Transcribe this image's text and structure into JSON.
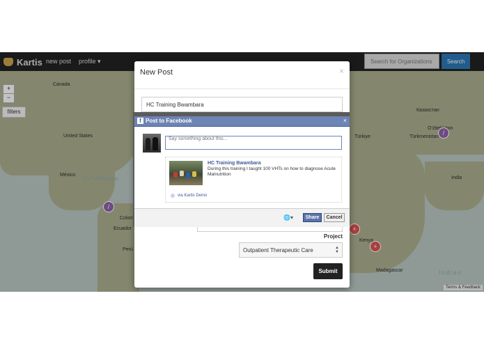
{
  "navbar": {
    "brand": "Kartis",
    "new_post": "new post",
    "profile": "profile",
    "profile_caret": "▾",
    "search_placeholder": "Search for Organizations",
    "search_button": "Search"
  },
  "map": {
    "zoom_in": "+",
    "zoom_out": "−",
    "filters": "filters",
    "labels": {
      "canada": "Canada",
      "united_states": "United States",
      "mexico": "México",
      "colombia": "Colombia",
      "ecuador": "Ecuador",
      "peru": "Perú",
      "kazakhstan": "Казахстан",
      "uzbekistan": "O'zbekiston",
      "turkmenistan": "Türkmenistan",
      "turkiye": "Türkiye",
      "kenya": "Kenya",
      "madagascar": "Madagascar",
      "india": "India"
    },
    "ocean_gulf": "Gulf of Mexico",
    "ocean_indian": "Indian",
    "attribution": "Terms & Feedback",
    "colors": {
      "water": "#b8c4c0",
      "land": "#a9ad8e",
      "marker_purple": "#8e60a6",
      "marker_red": "#d9534f"
    }
  },
  "modal": {
    "title": "New Post",
    "close": "×",
    "title_value": "HC Training Bwambara",
    "project_label": "Project",
    "project_value": "Outpatient Therapeutic Care",
    "submit": "Submit"
  },
  "facebook": {
    "dialog_title": "Post to Facebook",
    "close": "×",
    "logo": "f",
    "message_placeholder": "Say something about this...",
    "link_title": "HC Training Bwambara",
    "link_description": "During this training I taught 100 VHTs on how to diagnose Acute Malnutrition",
    "via": "via Kartis Demo",
    "share": "Share",
    "cancel": "Cancel",
    "colors": {
      "header": "#6d84b4",
      "share": "#5b74a8"
    }
  }
}
